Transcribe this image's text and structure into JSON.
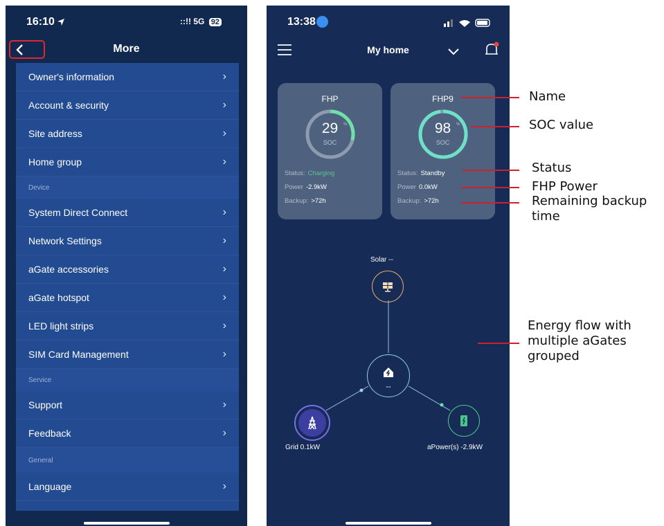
{
  "left": {
    "status_time": "16:10",
    "status_network": "5G",
    "battery": "92",
    "nav_title": "More",
    "menu": [
      {
        "type": "item",
        "label": "Owner's information"
      },
      {
        "type": "item",
        "label": "Account & security"
      },
      {
        "type": "item",
        "label": "Site address"
      },
      {
        "type": "item",
        "label": "Home group"
      },
      {
        "type": "section",
        "label": "Device"
      },
      {
        "type": "item",
        "label": "System Direct Connect"
      },
      {
        "type": "item",
        "label": "Network Settings"
      },
      {
        "type": "item",
        "label": "aGate accessories"
      },
      {
        "type": "item",
        "label": "aGate hotspot"
      },
      {
        "type": "item",
        "label": "LED light strips"
      },
      {
        "type": "item",
        "label": "SIM Card Management"
      },
      {
        "type": "section",
        "label": "Service"
      },
      {
        "type": "item",
        "label": "Support"
      },
      {
        "type": "item",
        "label": "Feedback"
      },
      {
        "type": "section",
        "label": "General"
      },
      {
        "type": "item",
        "label": "Language"
      }
    ]
  },
  "right": {
    "status_time": "13:38",
    "title": "My home",
    "cards": [
      {
        "name": "FHP",
        "soc": "29",
        "soc_fraction": 0.29,
        "soc_label": "SOC",
        "status_label": "Status:",
        "status": "Charging",
        "power_label": "Power",
        "power": "-2.9kW",
        "backup_label": "Backup:",
        "backup": ">72h"
      },
      {
        "name": "FHP9",
        "soc": "98",
        "soc_fraction": 0.98,
        "soc_label": "SOC",
        "status_label": "Status:",
        "status": "Standby",
        "power_label": "Power",
        "power": "0.0kW",
        "backup_label": "Backup:",
        "backup": ">72h"
      }
    ],
    "flow": {
      "solar": "Solar --",
      "home": "--",
      "grid": "Grid 0.1kW",
      "apower": "aPower(s) -2.9kW"
    }
  },
  "annotations": {
    "name": "Name",
    "soc": "SOC value",
    "status": "Status",
    "power": "FHP Power",
    "backup": "Remaining backup time",
    "energy": "Energy flow with multiple aGates grouped"
  },
  "colors": {
    "accent_red": "#e0262e",
    "charging_green": "#58c48e",
    "solar_orange": "#e2a868",
    "grid_purple": "#7b6de6",
    "apower_green": "#49c58b"
  }
}
